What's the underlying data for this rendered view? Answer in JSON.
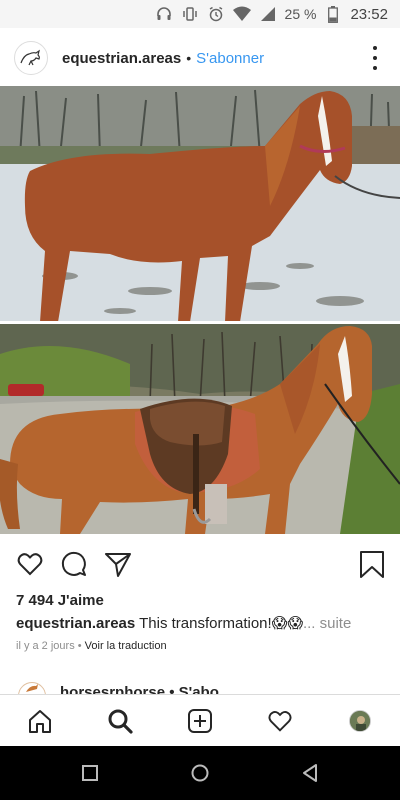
{
  "status_bar": {
    "battery_percent": "25 %",
    "time": "23:52",
    "icons": [
      "headphones-icon",
      "vibrate-icon",
      "alarm-icon",
      "wifi-icon",
      "signal-icon",
      "battery-icon"
    ]
  },
  "post": {
    "username": "equestrian.areas",
    "separator": "•",
    "follow_label": "S'abonner",
    "likes": "7 494 J'aime",
    "caption_user": "equestrian.areas",
    "caption_text": " This transformation!😱😱",
    "more_label": "... suite",
    "time_ago": "il y a 2 jours",
    "meta_separator": " • ",
    "translate_label": "Voir la traduction"
  },
  "next_post": {
    "username": "horsesrphorse • S'abo"
  },
  "colors": {
    "accent_blue": "#3897f0",
    "text": "#262626",
    "muted": "#8e8e8e"
  }
}
